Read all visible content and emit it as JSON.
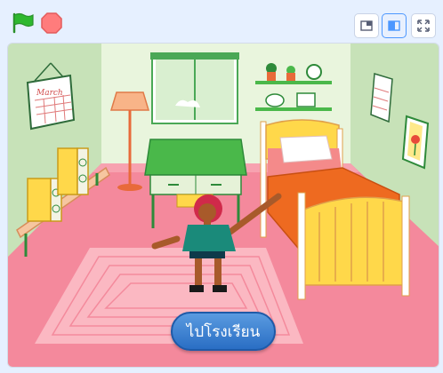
{
  "toolbar": {
    "green_flag_icon": "green-flag-icon",
    "stop_icon": "stop-sign-icon",
    "small_stage_icon": "small-stage-icon",
    "normal_stage_icon": "normal-stage-icon",
    "fullscreen_icon": "fullscreen-icon"
  },
  "stage": {
    "calendar_label": "March",
    "go_to_school_button": "ไปโรงเรียน"
  },
  "colors": {
    "background": "#e6f0ff",
    "flag_green": "#2eb82e",
    "stop_red": "#ff6b6b",
    "wall_green": "#c7e2b8",
    "floor_pink": "#f4899c",
    "button_blue": "#3a7fd0"
  }
}
